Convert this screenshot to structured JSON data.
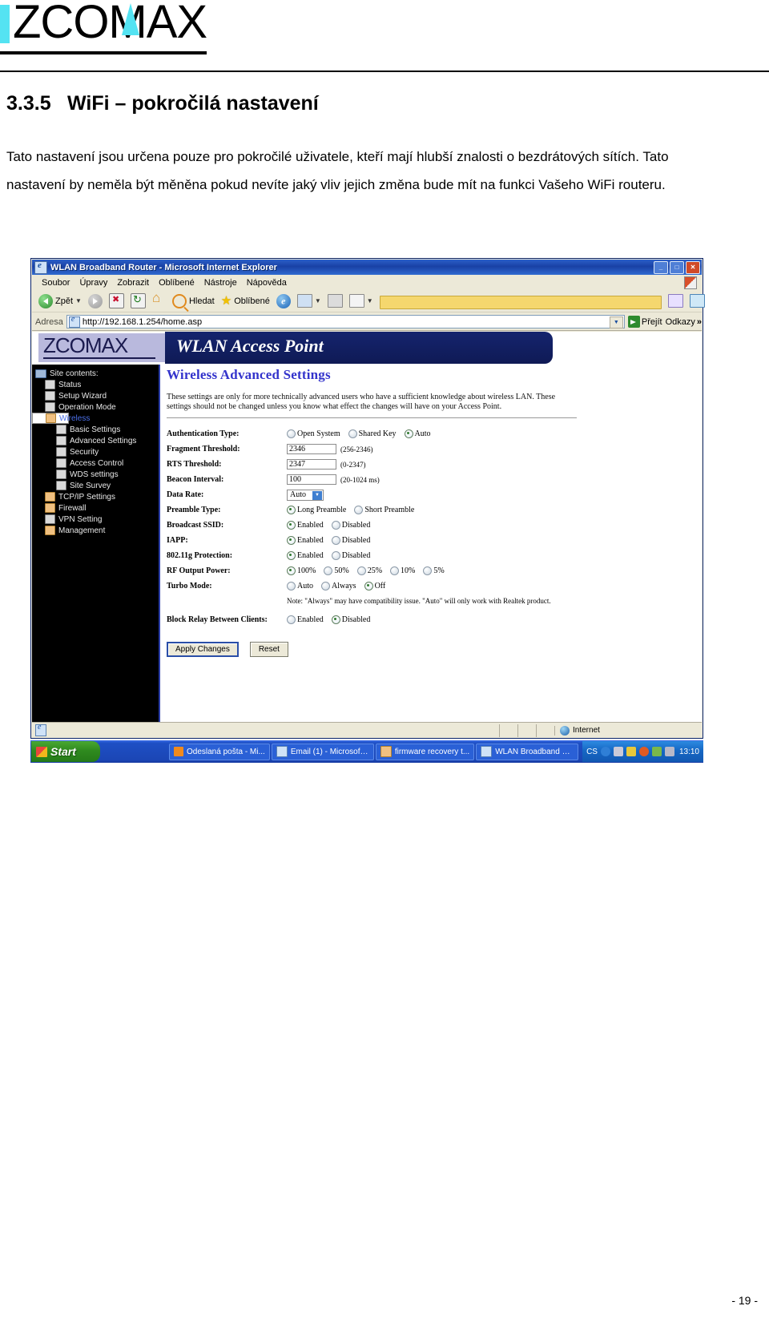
{
  "document": {
    "brand": "ZCOMAX",
    "section_number": "3.3.5",
    "section_title": "WiFi – pokročilá nastavení",
    "paragraph": "Tato nastavení jsou určena pouze pro pokročilé uživatele, kteří mají hlubší znalosti o bezdrátových sítích. Tato nastavení by neměla být měněna pokud nevíte jaký vliv jejich změna bude mít na funkci Vašeho WiFi routeru.",
    "page_number": "- 19 -"
  },
  "browser": {
    "window_title": "WLAN Broadband Router - Microsoft Internet Explorer",
    "window_buttons": {
      "minimize": "_",
      "maximize": "□",
      "close": "✕"
    },
    "menu": [
      "Soubor",
      "Úpravy",
      "Zobrazit",
      "Oblíbené",
      "Nástroje",
      "Nápověda"
    ],
    "toolbar": {
      "back": "Zpět",
      "forward": "",
      "stop": "",
      "refresh": "",
      "home": "",
      "search": "Hledat",
      "favorites": "Oblíbené",
      "history": "",
      "mail": "",
      "print": "",
      "edit": "",
      "note": "",
      "messenger": "",
      "people": ""
    },
    "address": {
      "label": "Adresa",
      "url": "http://192.168.1.254/home.asp",
      "go_label": "Přejít",
      "links_label": "Odkazy",
      "chevron": "»"
    },
    "status": {
      "zone": "Internet"
    }
  },
  "device_page": {
    "logo": "ZCOMAX",
    "banner_title": "WLAN Access Point",
    "sidebar": {
      "root": "Site contents:",
      "items": [
        {
          "label": "Status",
          "level": 1,
          "icon": "page-icon",
          "selected": false
        },
        {
          "label": "Setup Wizard",
          "level": 1,
          "icon": "page-icon",
          "selected": false
        },
        {
          "label": "Operation Mode",
          "level": 1,
          "icon": "page-icon",
          "selected": false
        },
        {
          "label": "Wireless",
          "level": 1,
          "icon": "folder-icon",
          "selected": true
        },
        {
          "label": "Basic Settings",
          "level": 2,
          "icon": "page-icon",
          "selected": false
        },
        {
          "label": "Advanced Settings",
          "level": 2,
          "icon": "page-icon",
          "selected": false
        },
        {
          "label": "Security",
          "level": 2,
          "icon": "page-icon",
          "selected": false
        },
        {
          "label": "Access Control",
          "level": 2,
          "icon": "page-icon",
          "selected": false
        },
        {
          "label": "WDS settings",
          "level": 2,
          "icon": "page-icon",
          "selected": false
        },
        {
          "label": "Site Survey",
          "level": 2,
          "icon": "page-icon",
          "selected": false
        },
        {
          "label": "TCP/IP Settings",
          "level": 1,
          "icon": "folder-icon",
          "selected": false
        },
        {
          "label": "Firewall",
          "level": 1,
          "icon": "folder-icon",
          "selected": false
        },
        {
          "label": "VPN Setting",
          "level": 1,
          "icon": "page-icon",
          "selected": false
        },
        {
          "label": "Management",
          "level": 1,
          "icon": "folder-icon",
          "selected": false
        }
      ]
    },
    "content": {
      "title": "Wireless Advanced Settings",
      "description": "These settings are only for more technically advanced users who have a sufficient knowledge about wireless LAN. These settings should not be changed unless you know what effect the changes will have on your Access Point.",
      "fields": {
        "auth_type": {
          "label": "Authentication Type:",
          "options": [
            "Open System",
            "Shared Key",
            "Auto"
          ],
          "selected": "Auto"
        },
        "fragment_threshold": {
          "label": "Fragment Threshold:",
          "value": "2346",
          "hint": "(256-2346)"
        },
        "rts_threshold": {
          "label": "RTS Threshold:",
          "value": "2347",
          "hint": "(0-2347)"
        },
        "beacon_interval": {
          "label": "Beacon Interval:",
          "value": "100",
          "hint": "(20-1024 ms)"
        },
        "data_rate": {
          "label": "Data Rate:",
          "value": "Auto"
        },
        "preamble_type": {
          "label": "Preamble Type:",
          "options": [
            "Long Preamble",
            "Short Preamble"
          ],
          "selected": "Long Preamble"
        },
        "broadcast_ssid": {
          "label": "Broadcast SSID:",
          "options": [
            "Enabled",
            "Disabled"
          ],
          "selected": "Enabled"
        },
        "iapp": {
          "label": "IAPP:",
          "options": [
            "Enabled",
            "Disabled"
          ],
          "selected": "Enabled"
        },
        "protection_80211g": {
          "label": "802.11g Protection:",
          "options": [
            "Enabled",
            "Disabled"
          ],
          "selected": "Enabled"
        },
        "rf_output_power": {
          "label": "RF Output Power:",
          "options": [
            "100%",
            "50%",
            "25%",
            "10%",
            "5%"
          ],
          "selected": "100%"
        },
        "turbo_mode": {
          "label": "Turbo Mode:",
          "options": [
            "Auto",
            "Always",
            "Off"
          ],
          "selected": "Off",
          "note": "Note: \"Always\" may have compatibility issue. \"Auto\" will only work with Realtek product."
        },
        "block_relay": {
          "label": "Block Relay Between Clients:",
          "options": [
            "Enabled",
            "Disabled"
          ],
          "selected": "Disabled"
        }
      },
      "buttons": {
        "apply": "Apply Changes",
        "reset": "Reset"
      }
    }
  },
  "taskbar": {
    "start": "Start",
    "tasks": [
      {
        "label": "Odeslaná pošta - Mi...",
        "icon": "outlook-icon"
      },
      {
        "label": "Email (1) - Microsoft ...",
        "icon": "ie-icon"
      },
      {
        "label": "firmware recovery t...",
        "icon": "folder-icon"
      },
      {
        "label": "WLAN Broadband Ro...",
        "icon": "ie-icon"
      }
    ],
    "tray": {
      "language": "CS",
      "clock": "13:10"
    }
  },
  "colors": {
    "accent_cyan": "#54e3f2",
    "title_blue": "#3333cc",
    "banner_navy": "#15246e",
    "sidebar_black": "#000000",
    "selected_link": "#4a6fe8"
  }
}
